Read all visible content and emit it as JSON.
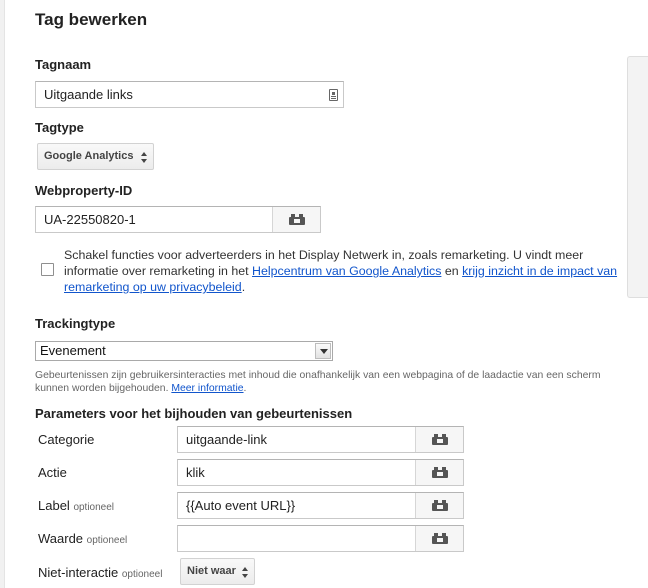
{
  "page": {
    "title": "Tag bewerken"
  },
  "tag_name": {
    "label": "Tagnaam",
    "value": "Uitgaande links"
  },
  "tag_type": {
    "label": "Tagtype",
    "selected": "Google Analytics"
  },
  "web_property": {
    "label": "Webproperty-ID",
    "value": "UA-22550820-1"
  },
  "remarketing": {
    "checked": false,
    "text_1": "Schakel functies voor adverteerders in het Display Netwerk in, zoals remarketing. U vindt meer informatie over remarketing in het ",
    "link_1": "Helpcentrum van Google Analytics",
    "text_2": " en ",
    "link_2": "krijg inzicht in de impact van remarketing op uw privacybeleid",
    "text_3": "."
  },
  "tracking_type": {
    "label": "Trackingtype",
    "selected": "Evenement",
    "help_text": "Gebeurtenissen zijn gebruikersinteracties met inhoud die onafhankelijk van een webpagina of de laadactie van een scherm kunnen worden bijgehouden. ",
    "help_link": "Meer informatie",
    "help_end": "."
  },
  "event_params": {
    "heading": "Parameters voor het bijhouden van gebeurtenissen",
    "category": {
      "label": "Categorie",
      "value": "uitgaande-link"
    },
    "action": {
      "label": "Actie",
      "value": "klik"
    },
    "label": {
      "label": "Label",
      "optional": "optioneel",
      "value": "{{Auto event URL}}"
    },
    "value": {
      "label": "Waarde",
      "optional": "optioneel",
      "value": ""
    },
    "non_interaction": {
      "label": "Niet-interactie",
      "optional": "optioneel",
      "selected": "Niet waar"
    }
  },
  "icons": {
    "macro": "macro-lego-icon",
    "field": "text-field-icon"
  },
  "colors": {
    "link": "#1155cc",
    "text": "#222222"
  }
}
